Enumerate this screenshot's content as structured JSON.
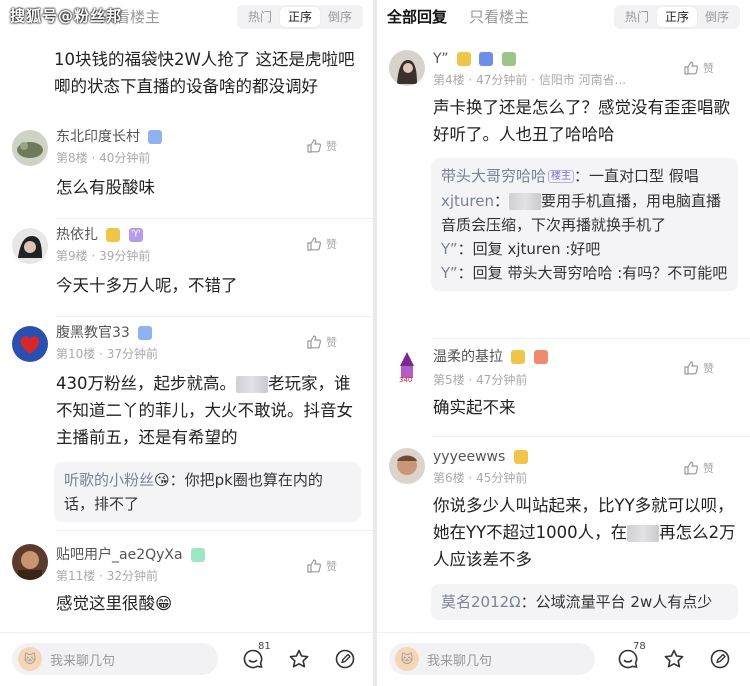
{
  "watermark": "搜狐号@粉丝邦",
  "left": {
    "tabs": {
      "main": "",
      "sub": "只看楼主"
    },
    "sort": [
      "热门",
      "正序",
      "倒序"
    ],
    "continued_text": "10块钱的福袋快2W人抢了 这还是虎啦吧唧的状态下直播的设备啥的都没调好",
    "comments": [
      {
        "user": "东北印度长村",
        "floor": "第8楼",
        "time": "40分钟前",
        "text": "怎么有股酸味",
        "like": "赞"
      },
      {
        "user": "热依扎",
        "floor": "第9楼",
        "time": "39分钟前",
        "text": "今天十多万人呢，不错了",
        "like": "赞",
        "zodiac": "♈"
      },
      {
        "user": "腹黑教官33",
        "floor": "第10楼",
        "time": "37分钟前",
        "text_a": "430万粉丝，起步就高。",
        "text_b": "老玩家，谁不知道二丫的菲儿，大火不敢说。抖音女主播前五，还是有希望的",
        "like": "赞",
        "reply": {
          "name": "听歌的小粉丝",
          "emoji": "😘",
          "text": "：你把pk圈也算在内的话，排不了"
        }
      },
      {
        "user": "贴吧用户_ae2QyXa",
        "floor": "第11楼",
        "time": "32分钟前",
        "text": "感觉这里很酸",
        "emoji": "😁",
        "like": "赞"
      }
    ],
    "bottom": {
      "placeholder": "我来聊几句",
      "count": "81"
    }
  },
  "right": {
    "tabs": {
      "main": "全部回复",
      "sub": "只看楼主"
    },
    "sort": [
      "热门",
      "正序",
      "倒序"
    ],
    "comments": [
      {
        "user": "Y”",
        "floor": "第4楼",
        "time": "47分钟前",
        "location": "信阳市 河南省...",
        "text": "声卡换了还是怎么了？感觉没有歪歪唱歌好听了。人也丑了哈哈哈",
        "like": "赞",
        "replies": [
          {
            "name": "带头大哥穷哈哈",
            "tag": "楼主",
            "text": "：一直对口型 假唱"
          },
          {
            "name": "xjturen",
            "text_a": "：",
            "text_b": "要用手机直播，用电脑直播音质会压缩，下次再播就换手机了"
          },
          {
            "name": "Y”",
            "text": "：回复 xjturen :好吧"
          },
          {
            "name": "Y”",
            "text": "：回复 带头大哥穷哈哈 :有吗？不可能吧"
          }
        ]
      },
      {
        "user": "温柔的基拉",
        "floor": "第5楼",
        "time": "47分钟前",
        "text": "确实起不来",
        "like": "赞"
      },
      {
        "user": "yyyeewws",
        "floor": "第6楼",
        "time": "45分钟前",
        "text_a": "你说多少人叫站起来，比YY多就可以呗，她在YY不超过1000人，在",
        "text_b": "再怎么2万人应该差不多",
        "like": "赞",
        "reply": {
          "name": "莫名2012Ω",
          "text": "：公域流量平台 2w人有点少"
        }
      }
    ],
    "bottom": {
      "placeholder": "我来聊几句",
      "count": "78"
    }
  }
}
